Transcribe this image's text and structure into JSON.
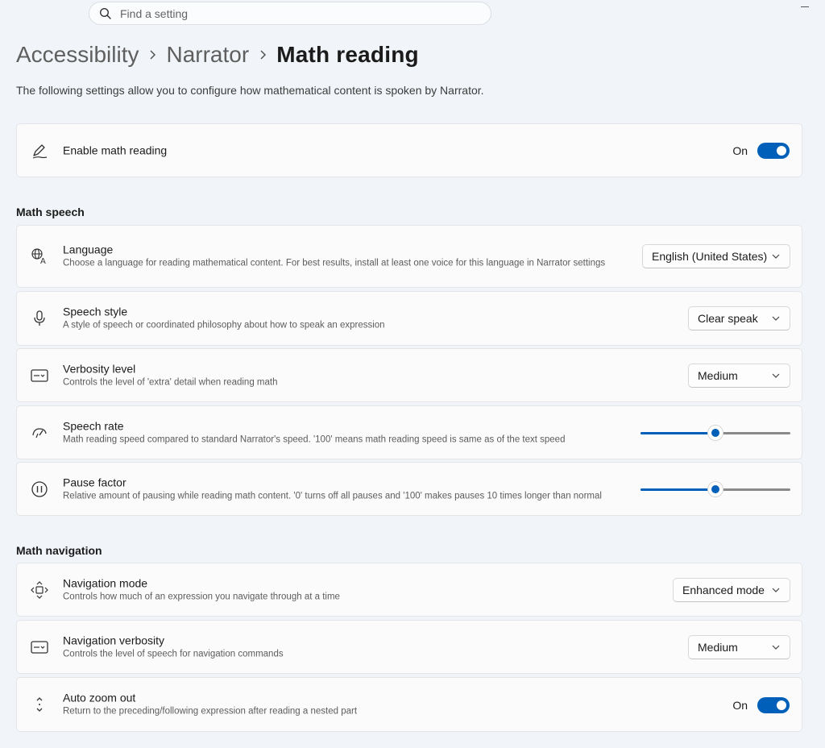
{
  "search": {
    "placeholder": "Find a setting",
    "icon": "search-icon"
  },
  "breadcrumb": {
    "items": [
      "Accessibility",
      "Narrator",
      "Math reading"
    ]
  },
  "description": "The following settings allow you to configure how mathematical content is spoken by Narrator.",
  "accent_color": "#005fb8",
  "enable_math_reading": {
    "title": "Enable math reading",
    "state": "On",
    "checked": true,
    "icon": "pen-icon"
  },
  "sections": {
    "math_speech": "Math speech",
    "math_navigation": "Math navigation"
  },
  "language": {
    "title": "Language",
    "description": "Choose a language for reading mathematical content. For best results, install at least one voice for this language in Narrator settings",
    "value": "English (United States)",
    "icon": "language-icon"
  },
  "speech_style": {
    "title": "Speech style",
    "description": "A style of speech or coordinated philosophy about how to speak an expression",
    "value": "Clear speak",
    "icon": "microphone-icon"
  },
  "verbosity_level": {
    "title": "Verbosity level",
    "description": "Controls the level of 'extra' detail when reading math",
    "value": "Medium",
    "icon": "keyboard-icon"
  },
  "speech_rate": {
    "title": "Speech rate",
    "description": "Math reading speed compared to standard Narrator's speed. '100' means math reading speed is same as of the text speed",
    "level_fraction": 0.5,
    "icon": "speed-icon"
  },
  "pause_factor": {
    "title": "Pause factor",
    "description": "Relative amount of pausing while reading math content. '0' turns off all pauses and '100' makes pauses 10 times longer than normal",
    "level_fraction": 0.5,
    "icon": "pause-icon"
  },
  "navigation_mode": {
    "title": "Navigation mode",
    "description": "Controls how much of an expression you navigate through at a time",
    "value": "Enhanced mode",
    "icon": "navigation-icon"
  },
  "navigation_verbosity": {
    "title": "Navigation verbosity",
    "description": "Controls the level of speech for navigation commands",
    "value": "Medium",
    "icon": "keyboard-icon"
  },
  "auto_zoom_out": {
    "title": "Auto zoom out",
    "description": "Return to the preceding/following expression after reading a nested part",
    "state": "On",
    "checked": true,
    "icon": "expand-vertical-icon"
  }
}
